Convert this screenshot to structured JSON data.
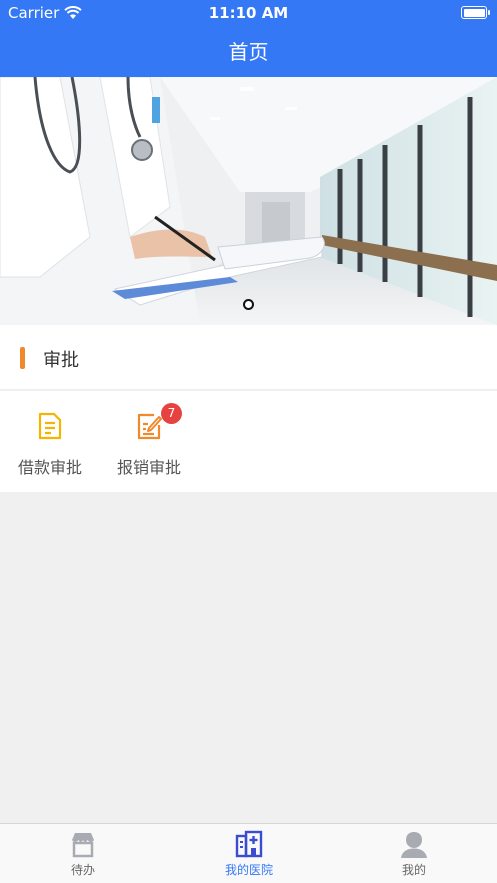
{
  "status_bar": {
    "carrier": "Carrier",
    "time": "11:10 AM"
  },
  "nav": {
    "title": "首页"
  },
  "section": {
    "title": "审批"
  },
  "grid": [
    {
      "label": "借款审批",
      "icon": "document-icon",
      "color": "#f5b400"
    },
    {
      "label": "报销审批",
      "icon": "edit-document-icon",
      "color": "#f0892a",
      "badge": "7"
    }
  ],
  "tabs": [
    {
      "label": "待办",
      "icon": "store-icon",
      "active": false
    },
    {
      "label": "我的医院",
      "icon": "hospital-icon",
      "active": true
    },
    {
      "label": "我的",
      "icon": "person-icon",
      "active": false
    }
  ],
  "colors": {
    "primary": "#3478f6",
    "accent": "#f0892a",
    "badge": "#e64340"
  }
}
